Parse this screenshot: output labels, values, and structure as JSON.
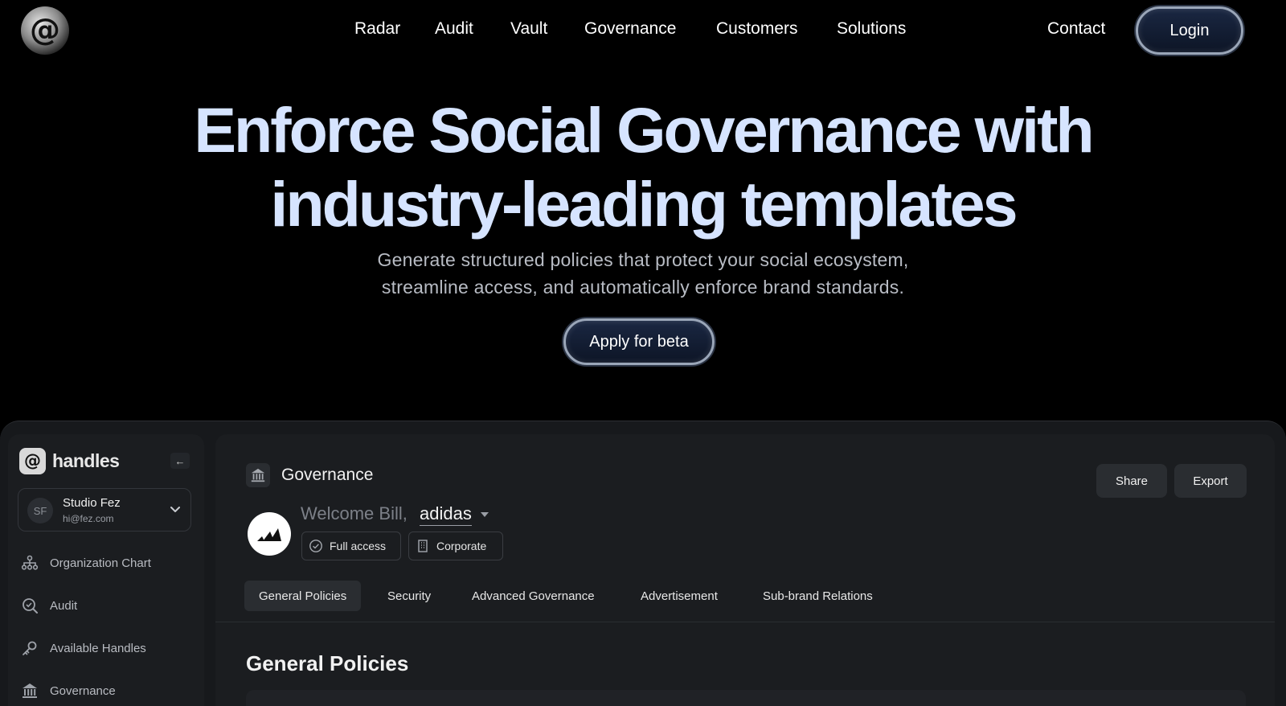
{
  "nav": {
    "logo_glyph": "@",
    "links": [
      "Radar",
      "Audit",
      "Vault",
      "Governance",
      "Customers",
      "Solutions"
    ],
    "contact": "Contact",
    "login": "Login"
  },
  "hero": {
    "title_line1": "Enforce Social Governance with",
    "title_line2": "industry-leading templates",
    "subtitle_line1": "Generate structured policies that protect your social ecosystem,",
    "subtitle_line2": "streamline access, and automatically enforce brand standards.",
    "cta": "Apply for beta"
  },
  "sidebar": {
    "brand_glyph": "@",
    "brand_name": "handles",
    "collapse_glyph": "←",
    "workspace": {
      "initials": "SF",
      "name": "Studio Fez",
      "email": "hi@fez.com"
    },
    "items": [
      {
        "label": "Organization Chart",
        "icon": "org-chart-icon"
      },
      {
        "label": "Audit",
        "icon": "audit-search-icon"
      },
      {
        "label": "Available Handles",
        "icon": "key-icon"
      },
      {
        "label": "Governance",
        "icon": "bank-icon"
      }
    ]
  },
  "main": {
    "title": "Governance",
    "share": "Share",
    "export": "Export",
    "welcome": "Welcome Bill,",
    "account": "adidas",
    "chips": [
      "Full access",
      "Corporate"
    ],
    "tabs": [
      "General Policies",
      "Security",
      "Advanced Governance",
      "Advertisement",
      "Sub-brand Relations"
    ],
    "active_tab": "General Policies",
    "section_title": "General Policies"
  },
  "colors": {
    "hero_title": "#d6e4ff",
    "button_fill": "#0d1526",
    "button_ring": "#9aa6b8",
    "panel": "#1b1d20"
  }
}
